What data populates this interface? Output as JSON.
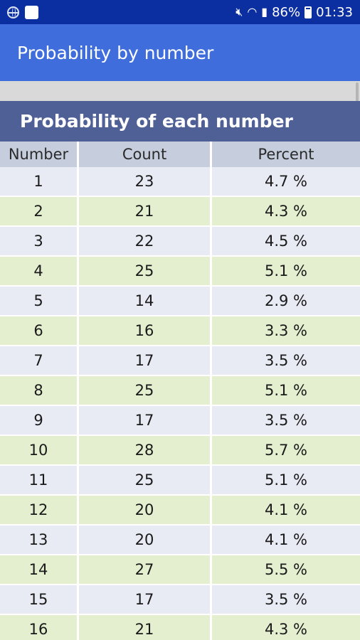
{
  "status_bar": {
    "battery": "86%",
    "time": "01:33"
  },
  "app_bar": {
    "title": "Probability by number"
  },
  "section": {
    "title": "Probability of each number"
  },
  "table": {
    "headers": [
      "Number",
      "Count",
      "Percent"
    ],
    "rows": [
      [
        "1",
        "23",
        "4.7 %"
      ],
      [
        "2",
        "21",
        "4.3 %"
      ],
      [
        "3",
        "22",
        "4.5 %"
      ],
      [
        "4",
        "25",
        "5.1 %"
      ],
      [
        "5",
        "14",
        "2.9 %"
      ],
      [
        "6",
        "16",
        "3.3 %"
      ],
      [
        "7",
        "17",
        "3.5 %"
      ],
      [
        "8",
        "25",
        "5.1 %"
      ],
      [
        "9",
        "17",
        "3.5 %"
      ],
      [
        "10",
        "28",
        "5.7 %"
      ],
      [
        "11",
        "25",
        "5.1 %"
      ],
      [
        "12",
        "20",
        "4.1 %"
      ],
      [
        "13",
        "20",
        "4.1 %"
      ],
      [
        "14",
        "27",
        "5.5 %"
      ],
      [
        "15",
        "17",
        "3.5 %"
      ],
      [
        "16",
        "21",
        "4.3 %"
      ]
    ]
  },
  "colors": {
    "status_bar": "#0b2fa1",
    "app_bar": "#3f6ddc",
    "section_header": "#4f6096",
    "table_header": "#c6cede",
    "row_odd": "#e8eaf4",
    "row_even": "#e4efd0"
  },
  "icons": [
    "globe-icon",
    "notification-square-icon",
    "mute-icon",
    "wifi-icon",
    "signal-icon",
    "battery-icon"
  ]
}
